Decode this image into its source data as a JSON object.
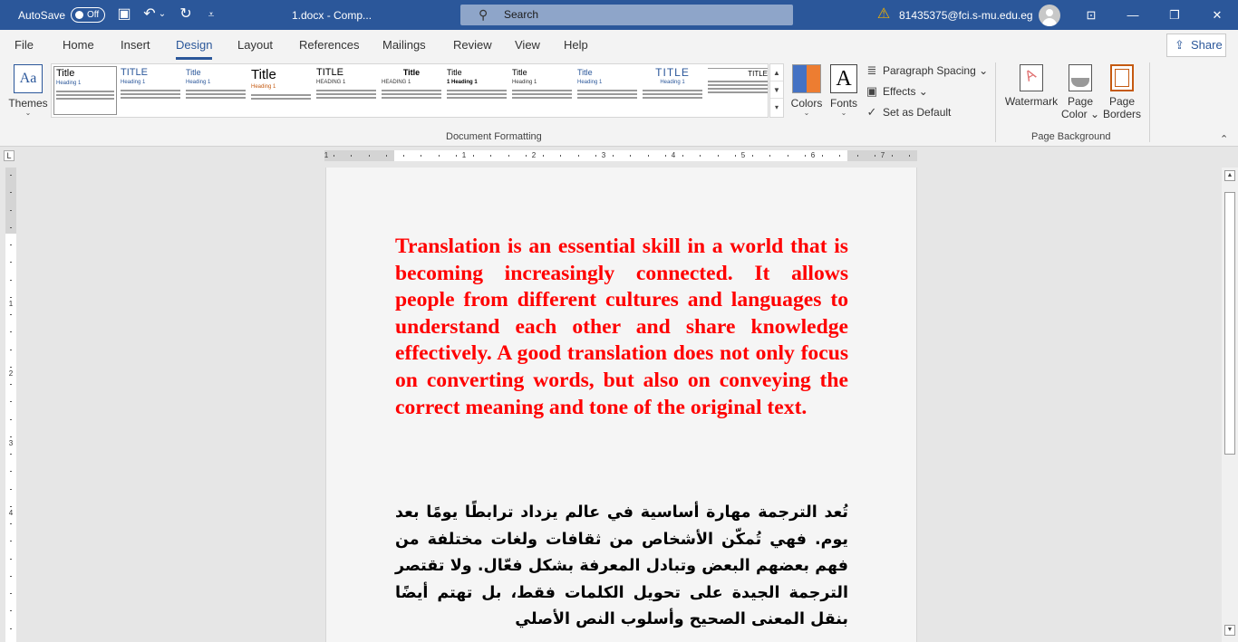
{
  "titlebar": {
    "autosave_label": "AutoSave",
    "autosave_state": "Off",
    "doc_title": "1.docx  -  Comp...",
    "title_chevron": "⌄",
    "search_placeholder": "Search",
    "account": "81435375@fci.s-mu.edu.eg",
    "icons": {
      "save": "save-icon",
      "undo": "undo-icon",
      "redo": "redo-icon",
      "customize": "customize-qat-icon",
      "warning": "warning-icon",
      "ribbon_display": "ribbon-display-icon"
    },
    "glyphs": {
      "save": "▣",
      "undo": "↶",
      "undo_more": "⌄",
      "redo": "↻",
      "customize": "⩡",
      "search": "⚲",
      "warning": "⚠",
      "ribbon_display": "⊡",
      "minimize": "—",
      "maximize": "❐",
      "close": "✕"
    }
  },
  "menu": {
    "items": [
      "File",
      "Home",
      "Insert",
      "Design",
      "Layout",
      "References",
      "Mailings",
      "Review",
      "View",
      "Help"
    ],
    "active": "Design",
    "share_label": "Share"
  },
  "ribbon": {
    "themes_label": "Themes",
    "themes_glyph": "Aa",
    "style_sets": [
      {
        "title": "Title",
        "heading": "Heading 1"
      },
      {
        "title": "TITLE",
        "heading": "Heading 1"
      },
      {
        "title": "Title",
        "heading": "Heading 1"
      },
      {
        "title": "Title",
        "heading": "Heading 1"
      },
      {
        "title": "TITLE",
        "heading": "HEADING 1"
      },
      {
        "title": "Title",
        "heading": "HEADING 1"
      },
      {
        "title": "Title",
        "heading": "1   Heading 1"
      },
      {
        "title": "Title",
        "heading": "Heading 1"
      },
      {
        "title": "Title",
        "heading": "Heading 1"
      },
      {
        "title": "TITLE",
        "heading": "Heading 1"
      },
      {
        "title": "TITLE",
        "heading": ""
      }
    ],
    "gallery_arrows": [
      "▲",
      "▼",
      "▾"
    ],
    "colors_label": "Colors",
    "fonts_label": "Fonts",
    "fonts_glyph": "A",
    "paragraph_spacing_label": "Paragraph Spacing ⌄",
    "effects_label": "Effects ⌄",
    "set_default_label": "Set as Default",
    "small_glyphs": {
      "paragraph_spacing": "≣",
      "effects": "▣",
      "set_default": "✓"
    },
    "document_formatting_label": "Document Formatting",
    "watermark_label": "Watermark",
    "page_color_label": "Page\nColor ⌄",
    "page_color_line1": "Page",
    "page_color_line2": "Color ⌄",
    "page_borders_line1": "Page",
    "page_borders_line2": "Borders",
    "page_background_label": "Page Background",
    "collapse_glyph": "⌃"
  },
  "ruler": {
    "corner_glyph": "L",
    "h_numbers": [
      "1",
      "1",
      "2",
      "3",
      "4",
      "5",
      "6",
      "7"
    ],
    "v_numbers": [
      "1",
      "2",
      "3",
      "4"
    ]
  },
  "document": {
    "english_paragraph": "Translation is an essential skill in a world that is becoming increasingly connected. It allows people from different cultures and languages to understand each other and share knowledge effectively. A good translation does not only focus on converting words, but also on conveying the correct meaning and tone of the original text.",
    "english_color": "#ff0000",
    "arabic_paragraph": "تُعد الترجمة مهارة أساسية في عالم يزداد ترابطًا يومًا بعد يوم. فهي تُمكّن الأشخاص من ثقافات ولغات مختلفة من فهم بعضهم البعض وتبادل المعرفة بشكل فعّال. ولا تقتصر الترجمة الجيدة على تحويل الكلمات فقط، بل تهتم أيضًا بنقل المعنى الصحيح وأسلوب النص الأصلي"
  },
  "scrollbar": {
    "up": "▲",
    "down": "▼"
  },
  "colors": {
    "accent": "#2b579a",
    "titlebar": "#2b579a",
    "english_text": "#ff0000"
  }
}
